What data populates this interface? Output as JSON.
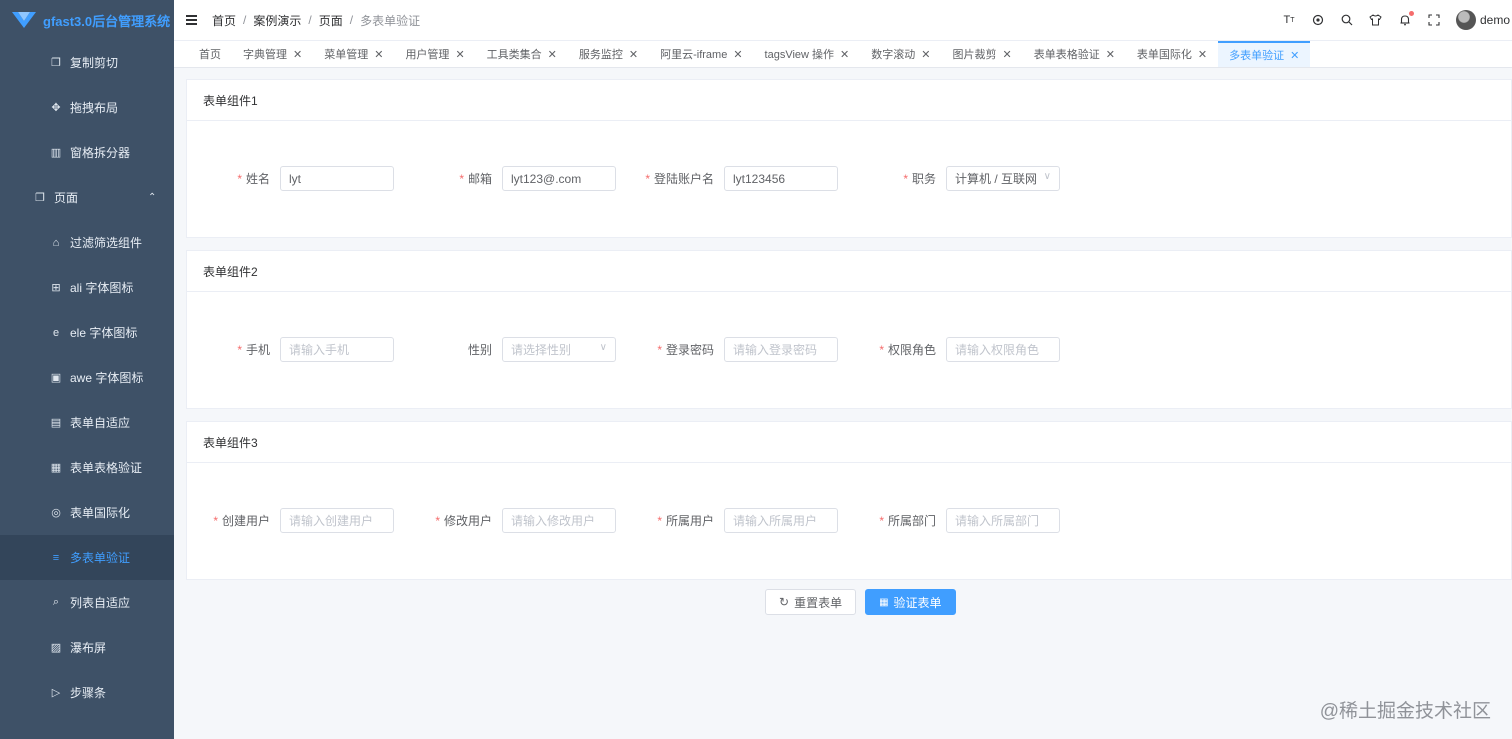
{
  "app": {
    "title": "gfast3.0后台管理系统"
  },
  "sidebar": {
    "items": [
      {
        "label": "复制剪切",
        "icon": "copy-icon"
      },
      {
        "label": "拖拽布局",
        "icon": "move-icon"
      },
      {
        "label": "窗格拆分器",
        "icon": "split-icon"
      },
      {
        "label": "页面",
        "icon": "page-icon",
        "parent": true,
        "expanded": true
      },
      {
        "label": "过滤筛选组件",
        "icon": "filter-icon"
      },
      {
        "label": "ali 字体图标",
        "icon": "ali-font-icon"
      },
      {
        "label": "ele 字体图标",
        "icon": "ele-font-icon"
      },
      {
        "label": "awe 字体图标",
        "icon": "awe-font-icon"
      },
      {
        "label": "表单自适应",
        "icon": "form-adapt-icon"
      },
      {
        "label": "表单表格验证",
        "icon": "form-table-icon"
      },
      {
        "label": "表单国际化",
        "icon": "globe-icon"
      },
      {
        "label": "多表单验证",
        "icon": "multi-form-icon",
        "active": true
      },
      {
        "label": "列表自适应",
        "icon": "list-adapt-icon"
      },
      {
        "label": "瀑布屏",
        "icon": "waterfall-icon"
      },
      {
        "label": "步骤条",
        "icon": "steps-icon"
      }
    ]
  },
  "breadcrumb": {
    "items": [
      "首页",
      "案例演示",
      "页面",
      "多表单验证"
    ]
  },
  "topbar": {
    "user": "demo"
  },
  "tags": [
    {
      "label": "首页",
      "closable": false
    },
    {
      "label": "字典管理",
      "closable": true
    },
    {
      "label": "菜单管理",
      "closable": true
    },
    {
      "label": "用户管理",
      "closable": true
    },
    {
      "label": "工具类集合",
      "closable": true
    },
    {
      "label": "服务监控",
      "closable": true
    },
    {
      "label": "阿里云-iframe",
      "closable": true
    },
    {
      "label": "tagsView 操作",
      "closable": true
    },
    {
      "label": "数字滚动",
      "closable": true
    },
    {
      "label": "图片裁剪",
      "closable": true
    },
    {
      "label": "表单表格验证",
      "closable": true
    },
    {
      "label": "表单国际化",
      "closable": true
    },
    {
      "label": "多表单验证",
      "closable": true,
      "active": true
    }
  ],
  "forms": [
    {
      "title": "表单组件1",
      "fields": [
        {
          "label": "姓名",
          "required": true,
          "value": "lyt",
          "placeholder": ""
        },
        {
          "label": "邮箱",
          "required": true,
          "value": "lyt123@.com",
          "placeholder": ""
        },
        {
          "label": "登陆账户名",
          "required": true,
          "value": "lyt123456",
          "placeholder": ""
        },
        {
          "label": "职务",
          "required": true,
          "value": "计算机 / 互联网",
          "placeholder": "",
          "select": true
        }
      ]
    },
    {
      "title": "表单组件2",
      "fields": [
        {
          "label": "手机",
          "required": true,
          "value": "",
          "placeholder": "请输入手机"
        },
        {
          "label": "性别",
          "required": false,
          "value": "",
          "placeholder": "请选择性别",
          "select": true
        },
        {
          "label": "登录密码",
          "required": true,
          "value": "",
          "placeholder": "请输入登录密码"
        },
        {
          "label": "权限角色",
          "required": true,
          "value": "",
          "placeholder": "请输入权限角色"
        }
      ]
    },
    {
      "title": "表单组件3",
      "fields": [
        {
          "label": "创建用户",
          "required": true,
          "value": "",
          "placeholder": "请输入创建用户"
        },
        {
          "label": "修改用户",
          "required": true,
          "value": "",
          "placeholder": "请输入修改用户"
        },
        {
          "label": "所属用户",
          "required": true,
          "value": "",
          "placeholder": "请输入所属用户"
        },
        {
          "label": "所属部门",
          "required": true,
          "value": "",
          "placeholder": "请输入所属部门"
        }
      ]
    }
  ],
  "actions": {
    "reset_label": "重置表单",
    "submit_label": "验证表单"
  },
  "watermark": "@稀土掘金技术社区",
  "colors": {
    "primary": "#409eff",
    "sidebar_bg": "#3e5167",
    "required": "#f56c6c"
  }
}
